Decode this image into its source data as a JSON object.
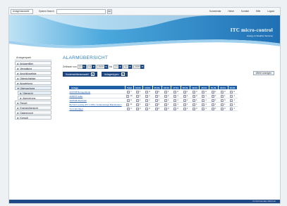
{
  "topbar": {
    "select_value": "Anlagenauswahl",
    "system_search_label": "System Search",
    "ok_label": "OK",
    "links": [
      "Kommentar",
      "Hinter",
      "Kontakt",
      "Hilfe",
      "Logout"
    ]
  },
  "brand": {
    "name": "ITC micro-control",
    "tagline": "Energy & Weather Services"
  },
  "sidebar": {
    "title": "Anlagenpark",
    "items": [
      {
        "label": "Anlagenfilter",
        "sub": false,
        "active": false
      },
      {
        "label": "Verwaltung",
        "sub": false,
        "active": false
      },
      {
        "label": "Anschlüsseliste",
        "sub": false,
        "active": false
      },
      {
        "label": "Übersichtsliste",
        "sub": false,
        "active": false
      },
      {
        "label": "Auswertung",
        "sub": false,
        "active": false
      },
      {
        "label": "Überwachung",
        "sub": false,
        "active": true
      },
      {
        "label": "Übersicht",
        "sub": true,
        "active": true
      },
      {
        "label": "Alarmierung",
        "sub": true,
        "active": false
      },
      {
        "label": "Report",
        "sub": false,
        "active": false
      },
      {
        "label": "Energieübersicht",
        "sub": false,
        "active": false
      },
      {
        "label": "Datenexport",
        "sub": false,
        "active": false
      },
      {
        "label": "Konsult",
        "sub": false,
        "active": false
      }
    ]
  },
  "main": {
    "title": "ALARMÜBERSICHT",
    "period_label": "Zeitraum von",
    "from": {
      "day": "13",
      "month": "04",
      "year": "2009"
    },
    "to_label": "bis",
    "to": {
      "day": "21",
      "month": "04",
      "year": "2009"
    },
    "select1": "Kostenstellenauswahl",
    "select2": "Anlagentypen",
    "export_label": "Werte anzeigen"
  },
  "table": {
    "headers": [
      "Anlage",
      "Total",
      "13.04.",
      "14.04.",
      "15.04.",
      "16.04.",
      "17.04.",
      "18.04.",
      "19.04.",
      "20.04.",
      "21.04.",
      "22.04.",
      "23.04."
    ],
    "rows": [
      {
        "name": "2007/08 Bürogebäude",
        "cells": [
          "7",
          "1",
          "0",
          "0",
          "1",
          "0",
          "0",
          "0",
          "0",
          "0",
          "0",
          "0"
        ]
      },
      {
        "name": "2006/07 Halle",
        "cells": [
          "10",
          "1",
          "1",
          "1",
          "2",
          "1",
          "1",
          "0",
          "1",
          "0",
          "1",
          "1"
        ]
      },
      {
        "name": "2007/08 Werkstatt",
        "cells": [
          "9",
          "1",
          "1",
          "1",
          "1",
          "1",
          "1",
          "1",
          "1",
          "0",
          "0",
          "1"
        ]
      },
      {
        "name": "BV Dorf Leipzig (PV 1 MW) / Außenanlage Baudirektion",
        "cells": [
          "11",
          "1",
          "1",
          "0",
          "1",
          "1",
          "1",
          "1",
          "1",
          "1",
          "1",
          "1"
        ]
      },
      {
        "name": "Turm EU-Wert",
        "cells": [
          "3",
          "0",
          "0",
          "0",
          "0",
          "0",
          "1",
          "0",
          "1",
          "0",
          "0",
          "1"
        ]
      }
    ]
  },
  "footer": {
    "text": "itc.Dortmunden-Werk.de"
  },
  "colors": {
    "accent": "#1f5fa8",
    "banner": "#2b8fd0",
    "title": "#2a7fc0"
  }
}
